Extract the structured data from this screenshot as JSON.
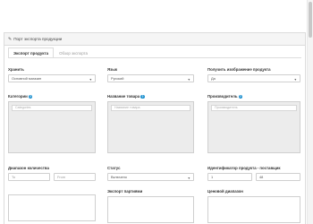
{
  "panel": {
    "title": "Порт экспорта продукции"
  },
  "tabs": [
    {
      "label": "Экспорт продукта"
    },
    {
      "label": "Обзор экспорта"
    }
  ],
  "fields": {
    "storage": {
      "label": "Хранить",
      "value": "Основной магазин"
    },
    "language": {
      "label": "Язык",
      "value": "Русский"
    },
    "get_image": {
      "label": "Получить изображение продукта",
      "value": "Да"
    },
    "categories": {
      "label": "Категории",
      "placeholder": "Categories"
    },
    "product_name": {
      "label": "Название товара",
      "placeholder": "Название товара"
    },
    "manufacturer": {
      "label": "Производитель",
      "placeholder": "Производитель"
    },
    "quantity_range": {
      "label": "Диапазон количества",
      "from": "To",
      "to": "From"
    },
    "status": {
      "label": "Статус",
      "value": "Включено"
    },
    "product_id_range": {
      "label": "Идентификатор продукта - поставщик",
      "from": "1",
      "to": "48"
    },
    "export_batch": {
      "label": "Экспорт партиями"
    },
    "price_range": {
      "label": "Ценовой диапазон"
    }
  }
}
